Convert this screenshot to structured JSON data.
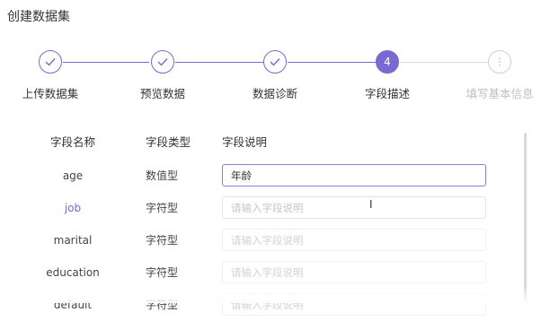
{
  "page": {
    "title": "创建数据集"
  },
  "steps": [
    {
      "label": "上传数据集",
      "status": "done"
    },
    {
      "label": "预览数据",
      "status": "done"
    },
    {
      "label": "数据诊断",
      "status": "done"
    },
    {
      "label": "字段描述",
      "status": "active",
      "number": "4"
    },
    {
      "label": "填写基本信息",
      "status": "pending"
    }
  ],
  "table": {
    "headers": {
      "name": "字段名称",
      "type": "字段类型",
      "desc": "字段说明"
    },
    "placeholder": "请输入字段说明",
    "rows": [
      {
        "name": "age",
        "type": "数值型",
        "desc": "年龄"
      },
      {
        "name": "job",
        "type": "字符型",
        "desc": ""
      },
      {
        "name": "marital",
        "type": "字符型",
        "desc": ""
      },
      {
        "name": "education",
        "type": "字符型",
        "desc": ""
      },
      {
        "name": "default",
        "type": "字符型",
        "desc": ""
      }
    ]
  },
  "colors": {
    "accent": "#7a68d3",
    "link": "#7a68d3"
  },
  "icons": {
    "done": "check-icon",
    "pending": "ellipsis-icon",
    "cursor": "text-cursor-icon"
  }
}
